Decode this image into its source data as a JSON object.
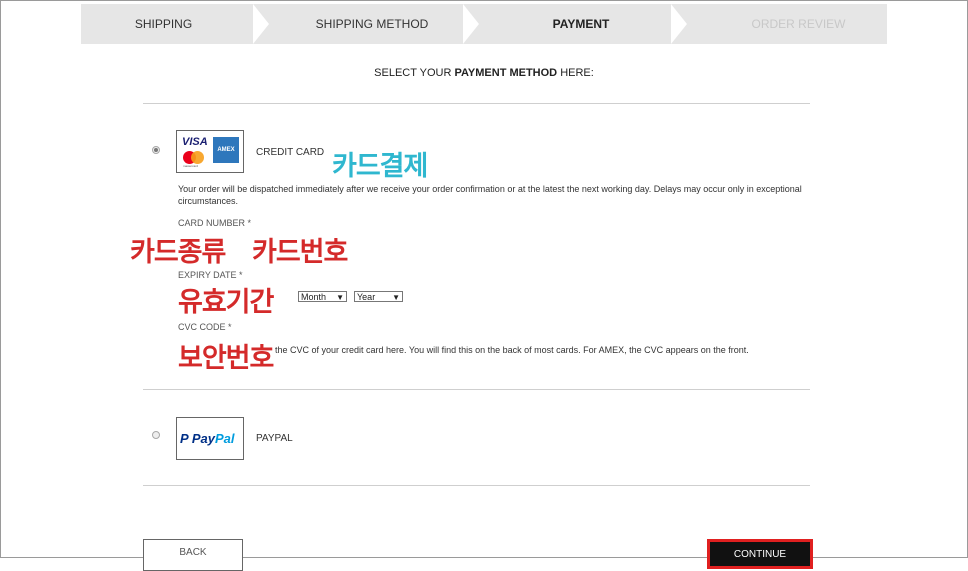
{
  "steps": [
    {
      "label": "SHIPPING"
    },
    {
      "label": "SHIPPING METHOD"
    },
    {
      "label": "PAYMENT"
    },
    {
      "label": "ORDER REVIEW"
    }
  ],
  "heading": {
    "prefix": "SELECT YOUR ",
    "bold": "PAYMENT METHOD",
    "suffix": " HERE:"
  },
  "credit_card": {
    "label": "CREDIT CARD",
    "logo": {
      "visa": "VISA",
      "mastercard_text": "mastercard",
      "amex": "AMEX"
    },
    "notice": "Your order will be dispatched immediately after we receive your order confirmation or at the latest the next working day. Delays may occur only in exceptional circumstances.",
    "card_number_label": "CARD NUMBER *",
    "expiry_label": "EXPIRY DATE *",
    "month_value": "Month",
    "year_value": "Year",
    "cvc_label": "CVC CODE *",
    "cvc_help": "the CVC of your credit card here. You will find this on the back of most cards. For AMEX, the CVC appears on the front."
  },
  "paypal": {
    "label": "PAYPAL",
    "logo_pay": "Pay",
    "logo_pal": "Pal",
    "logo_icon": "P"
  },
  "annotations": {
    "card_payment": "카드결제",
    "card_type": "카드종류",
    "card_number": "카드번호",
    "expiry": "유효기간",
    "security_code": "보안번호"
  },
  "buttons": {
    "back": "BACK",
    "continue": "CONTINUE"
  },
  "colors": {
    "accent_red": "#e02020",
    "annotation_red": "#d42a2a",
    "annotation_cyan": "#2fb7cf"
  }
}
